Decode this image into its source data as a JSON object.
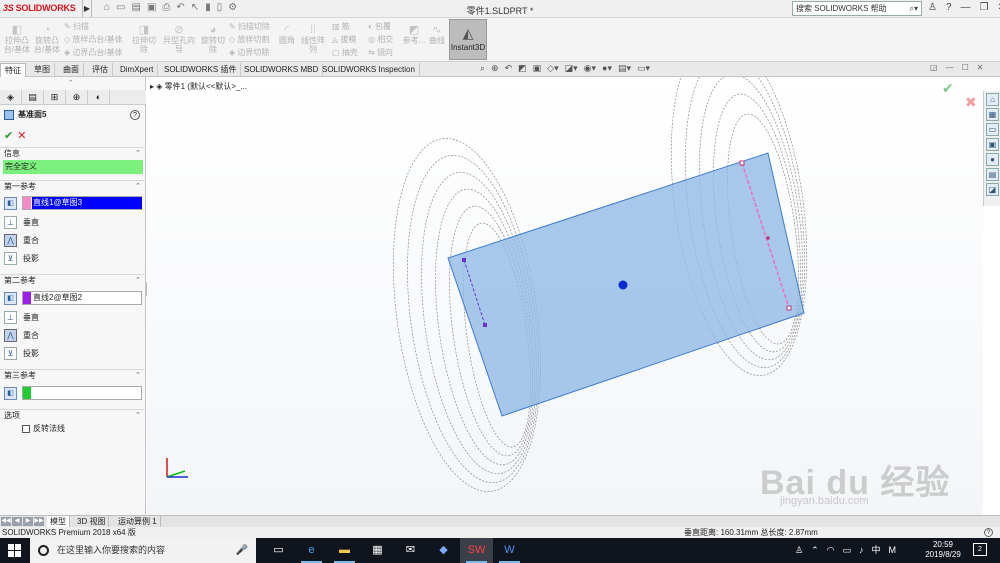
{
  "titlebar": {
    "app_logo": "SOLIDWORKS",
    "doc_title": "零件1.SLDPRT *",
    "help_search_placeholder": "搜索 SOLIDWORKS 帮助"
  },
  "ribbon": {
    "extrude_boss": "拉伸凸台/基体",
    "revolve_boss": "旋转凸台/基体",
    "sweep": "扫描",
    "loft_boss": "放样凸台/基体",
    "boundary_boss": "边界凸台/基体",
    "extrude_cut": "拉伸切除",
    "hole_wizard": "异型孔向导",
    "revolve_cut": "旋转切除",
    "swept_cut": "扫描切除",
    "lofted_cut": "放样切割",
    "boundary_cut": "边界切除",
    "fillet": "圆角",
    "linear_pattern": "线性阵列",
    "rib": "筋",
    "draft": "拔模",
    "shell": "抽壳",
    "wrap": "包覆",
    "intersect": "相交",
    "mirror": "镜向",
    "reference_geometry": "参考...",
    "curves": "曲线",
    "instant3d": "Instant3D"
  },
  "tabs": [
    "特征",
    "草图",
    "曲面",
    "评估",
    "DimXpert",
    "SOLIDWORKS 插件",
    "SOLIDWORKS MBD",
    "SOLIDWORKS Inspection"
  ],
  "active_tab": "特征",
  "panel": {
    "title": "基准面5",
    "help": "?",
    "sec_message": "信息",
    "message": "完全定义",
    "sec_first": "第一参考",
    "first_ref": "直线1@草图3",
    "first_ref_color": "#f78ac7",
    "opt_perpendicular": "垂直",
    "opt_coincident": "重合",
    "opt_project": "投影",
    "sec_second": "第二参考",
    "second_ref": "直线2@草图2",
    "second_ref_color": "#9b1fe8",
    "sec_third": "第三参考",
    "third_ref": "",
    "third_ref_color": "#22cc33",
    "sec_options": "选项",
    "flip_normal": "反转法线"
  },
  "viewport": {
    "tree_flyout": "零件1 (默认<<默认>_..."
  },
  "model_tabs": [
    "模型",
    "3D 视图",
    "运动算例 1"
  ],
  "statusbar": {
    "left": "SOLIDWORKS Premium 2018 x64 版",
    "right": "垂直距离: 160.31mm 总长度: 2.87mm"
  },
  "taskbar": {
    "search_placeholder": "在这里输入你要搜索的内容",
    "ime": "中",
    "ime2": "M",
    "time": "20:59",
    "date": "2019/8/29",
    "notifications": "2"
  },
  "watermark": {
    "text": "Bai du 经验",
    "sub": "jingyan.baidu.com"
  },
  "colors": {
    "plane_fill": "#8fb8e6",
    "plane_edge": "#3c7ccc",
    "accent_green": "#7cf07c",
    "active_ref": "#0000ff"
  }
}
